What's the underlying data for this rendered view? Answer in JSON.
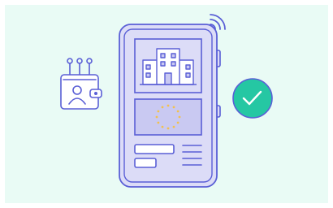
{
  "illustration": {
    "background_color": "#e9fbf5",
    "outline_color": "#5a5fd6",
    "phone_fill": "#dcdcf7",
    "panel_fill": "#c9c9f2",
    "star_color": "#f2c14e",
    "check_color": "#25c7a3",
    "icons": [
      "digital-wallet-icon",
      "smartphone-icon",
      "building-icon",
      "eu-flag-icon",
      "document-lines-icon",
      "wifi-signal-icon",
      "checkmark-badge-icon"
    ]
  }
}
